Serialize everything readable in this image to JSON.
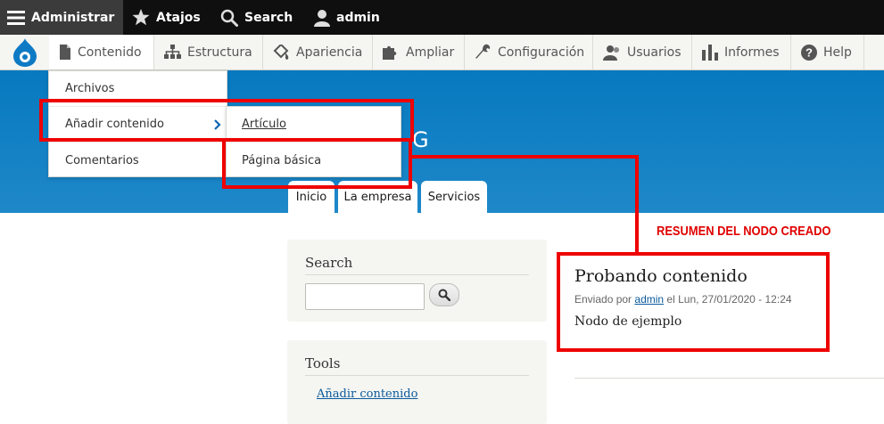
{
  "toolbar": {
    "admin_label": "Administrar",
    "shortcuts_label": "Atajos",
    "search_label": "Search",
    "user_label": "admin"
  },
  "tray": {
    "items": [
      {
        "label": "Contenido",
        "icon": "file-icon"
      },
      {
        "label": "Estructura",
        "icon": "sitemap-icon"
      },
      {
        "label": "Apariencia",
        "icon": "paint-icon"
      },
      {
        "label": "Ampliar",
        "icon": "puzzle-icon"
      },
      {
        "label": "Configuración",
        "icon": "wrench-icon"
      },
      {
        "label": "Usuarios",
        "icon": "users-icon"
      },
      {
        "label": "Informes",
        "icon": "chart-icon"
      },
      {
        "label": "Help",
        "icon": "help-icon"
      }
    ]
  },
  "content_menu": {
    "items": [
      "Archivos",
      "Añadir contenido",
      "Comentarios"
    ],
    "submenu": [
      "Artículo",
      "Página básica"
    ]
  },
  "header": {
    "site_title_fragment": "G",
    "tabs": [
      "Inicio",
      "La empresa",
      "Servicios"
    ]
  },
  "annotation": "RESUMEN DEL NODO CREADO",
  "sidebar": {
    "search_title": "Search",
    "tools_title": "Tools",
    "tools_link": "Añadir contenido"
  },
  "node": {
    "title": "Probando contenido",
    "meta_prefix": "Enviado por",
    "author": "admin",
    "meta_suffix": "el Lun, 27/01/2020 - 12:24",
    "body": "Nodo de ejemplo"
  },
  "colors": {
    "highlight": "#ee0000",
    "header_blue": "#0779bf",
    "toolbar_dark": "#0f0f0f"
  }
}
